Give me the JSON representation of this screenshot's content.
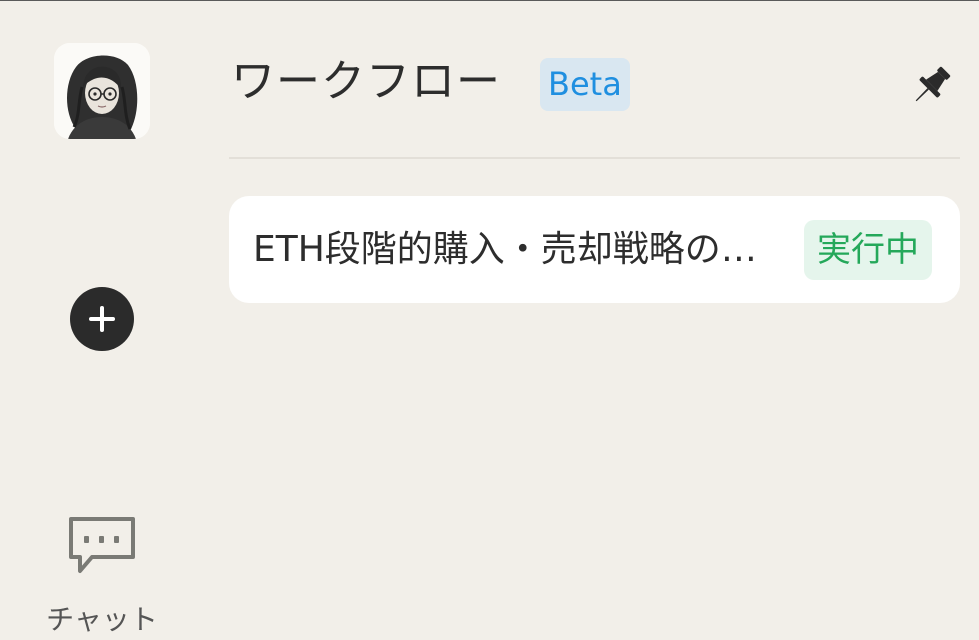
{
  "sidebar": {
    "avatar_alt": "user avatar",
    "chat_label": "チャット"
  },
  "header": {
    "title": "ワークフロー",
    "badge": "Beta"
  },
  "workflows": [
    {
      "title": "ETH段階的購入・売却戦略の自動実行",
      "status": "実行中"
    }
  ],
  "colors": {
    "background": "#f2efe9",
    "beta_badge_bg": "#d9e7f1",
    "beta_badge_text": "#1f8fe0",
    "status_badge_bg": "#e5f5ec",
    "status_badge_text": "#24a85a",
    "add_button": "#2b2b2b"
  },
  "icons": {
    "add": "plus-circle-icon",
    "chat": "chat-bubble-icon",
    "pin": "pin-icon"
  }
}
